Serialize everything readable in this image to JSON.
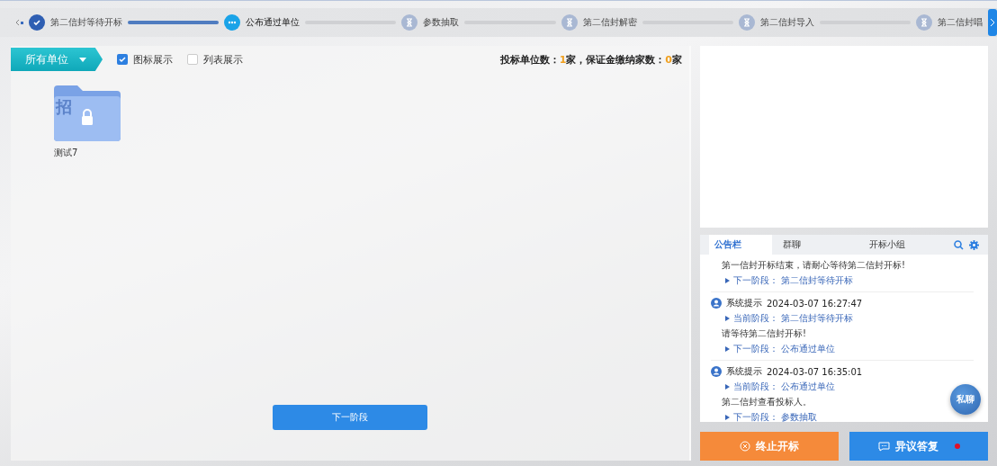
{
  "steps": [
    {
      "label": "第二信封等待开标",
      "done": true,
      "selected": false
    },
    {
      "label": "公布通过单位",
      "done": false,
      "selected": true
    },
    {
      "label": "参数抽取",
      "done": false,
      "selected": false
    },
    {
      "label": "第二信封解密",
      "done": false,
      "selected": false
    },
    {
      "label": "第二信封导入",
      "done": false,
      "selected": false
    },
    {
      "label": "第二信封唱",
      "done": false,
      "selected": false
    }
  ],
  "toolbar": {
    "unit_filter": "所有单位",
    "view_options": [
      {
        "label": "图标展示",
        "checked": true
      },
      {
        "label": "列表展示",
        "checked": false
      }
    ],
    "stats": [
      {
        "kind": "label",
        "text": "投标单位数："
      },
      {
        "kind": "count",
        "text": "1"
      },
      {
        "kind": "label",
        "text": "家，保证金缴纳家数："
      },
      {
        "kind": "count",
        "text": "0"
      },
      {
        "kind": "label",
        "text": "家"
      }
    ]
  },
  "bidders": [
    {
      "name": "测试7",
      "mark": "招",
      "locked": true
    }
  ],
  "next_button": "下一阶段",
  "chat": {
    "tabs": [
      {
        "label": "公告栏",
        "selected": true
      },
      {
        "label": "群聊",
        "selected": false
      },
      {
        "label": "开标小组",
        "selected": false
      }
    ],
    "messages": [
      {
        "lines": [
          {
            "kind": "text",
            "text": "第一信封开标结束，请耐心等待第二信封开标!"
          },
          {
            "kind": "stage",
            "text": "下一阶段：  第二信封等待开标"
          }
        ]
      },
      {
        "sender": "系统提示",
        "time": "2024-03-07 16:27:47",
        "lines": [
          {
            "kind": "stage",
            "text": "当前阶段：  第二信封等待开标"
          },
          {
            "kind": "text",
            "text": "请等待第二信封开标!"
          },
          {
            "kind": "stage",
            "text": "下一阶段：  公布通过单位"
          }
        ]
      },
      {
        "sender": "系统提示",
        "time": "2024-03-07 16:35:01",
        "lines": [
          {
            "kind": "stage",
            "text": "当前阶段：  公布通过单位"
          },
          {
            "kind": "text",
            "text": "第二信封查看投标人。"
          },
          {
            "kind": "stage",
            "text": "下一阶段：  参数抽取"
          }
        ]
      }
    ],
    "private_chat": "私聊"
  },
  "actions": [
    {
      "kind": "danger",
      "label": "终止开标",
      "notice": false
    },
    {
      "kind": "primary",
      "label": "异议答复",
      "notice": true
    }
  ]
}
